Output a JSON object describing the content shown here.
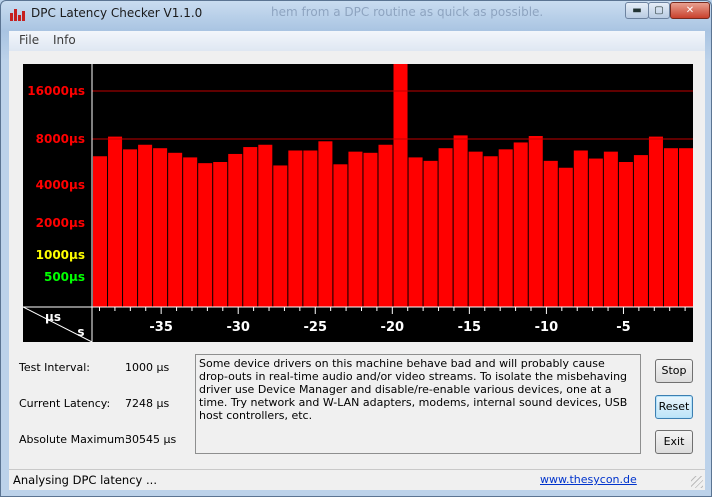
{
  "window": {
    "title": "DPC Latency Checker V1.1.0",
    "background_text": "hem from a DPC routine as quick as possible.",
    "controls": {
      "minimize": "▬",
      "maximize": "▢",
      "close": "✕"
    }
  },
  "menu": {
    "items": [
      "File",
      "Info"
    ]
  },
  "chart_data": {
    "type": "bar",
    "title": "",
    "xlabel": "s",
    "ylabel": "µs",
    "y_scale": "non-linear",
    "y_ticks": [
      {
        "label": "16000µs",
        "color": "#ff0000",
        "gridline": true
      },
      {
        "label": "8000µs",
        "color": "#ff0000",
        "gridline": true
      },
      {
        "label": "4000µs",
        "color": "#ff0000",
        "gridline": false
      },
      {
        "label": "2000µs",
        "color": "#ff0000",
        "gridline": false
      },
      {
        "label": "1000µs",
        "color": "#ffff00",
        "gridline": false
      },
      {
        "label": "500µs",
        "color": "#00ff00",
        "gridline": false
      }
    ],
    "x_ticks": [
      "-35",
      "-30",
      "-25",
      "-20",
      "-15",
      "-10",
      "-5"
    ],
    "xlim": [
      -39,
      0
    ],
    "bar_color": "#ff0000",
    "values": [
      6500,
      8400,
      7100,
      7500,
      7200,
      6800,
      6400,
      5900,
      6000,
      6700,
      7300,
      7500,
      5700,
      7000,
      7000,
      7800,
      5800,
      6900,
      6800,
      7500,
      30545,
      6400,
      6100,
      7200,
      8600,
      6900,
      6500,
      7100,
      7700,
      8500,
      6100,
      5500,
      7000,
      6300,
      6900,
      6000,
      6600,
      8400,
      7200,
      7200
    ]
  },
  "info": {
    "test_interval": {
      "label": "Test Interval:",
      "value": "1000 µs"
    },
    "current_latency": {
      "label": "Current Latency:",
      "value": "7248 µs"
    },
    "absolute_maximum": {
      "label": "Absolute Maximum:",
      "value": "30545 µs"
    }
  },
  "message": "Some device drivers on this machine behave bad and will probably cause drop-outs in real-time audio and/or video streams. To isolate the misbehaving driver use Device Manager and disable/re-enable various devices, one at a time. Try network and W-LAN adapters, modems, internal sound devices, USB host controllers, etc.",
  "buttons": {
    "stop": "Stop",
    "reset": "Reset",
    "exit": "Exit"
  },
  "status": {
    "text": "Analysing DPC latency ...",
    "link": "www.thesycon.de"
  }
}
